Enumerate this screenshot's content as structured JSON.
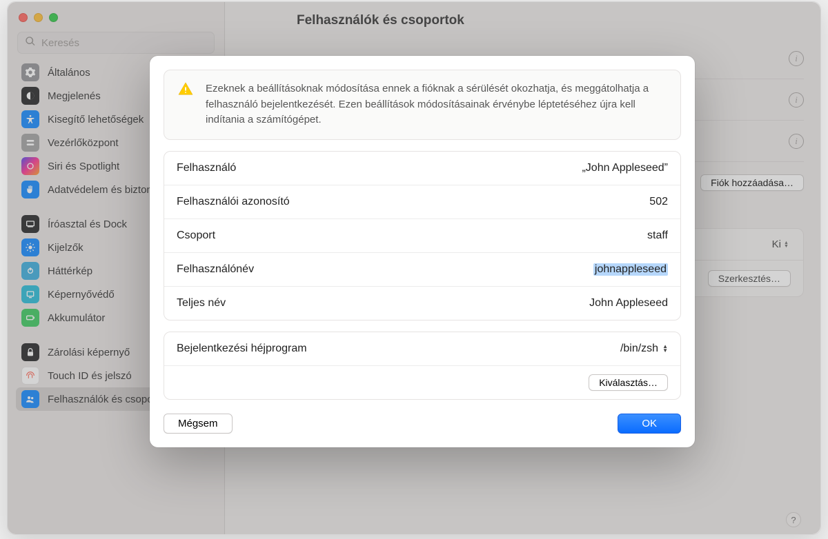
{
  "window": {
    "title": "Felhasználók és csoportok",
    "search_placeholder": "Keresés"
  },
  "sidebar": {
    "items": [
      {
        "label": "Általános",
        "color": "#8e8e93",
        "icon": "gear"
      },
      {
        "label": "Megjelenés",
        "color": "#1c1c1e",
        "icon": "appearance"
      },
      {
        "label": "Kisegítő lehetőségek",
        "color": "#0a84ff",
        "icon": "accessibility"
      },
      {
        "label": "Vezérlőközpont",
        "color": "#9e9e9e",
        "icon": "controls"
      },
      {
        "label": "Siri és Spotlight",
        "color": "#1b1b2b",
        "icon": "siri"
      },
      {
        "label": "Adatvédelem és biztonság",
        "color": "#0a84ff",
        "icon": "hand"
      }
    ],
    "items2": [
      {
        "label": "Íróasztal és Dock",
        "color": "#1c1c1e",
        "icon": "dock"
      },
      {
        "label": "Kijelzők",
        "color": "#0a84ff",
        "icon": "brightness"
      },
      {
        "label": "Háttérkép",
        "color": "#34aadc",
        "icon": "wallpaper"
      },
      {
        "label": "Képernyővédő",
        "color": "#20b9d6",
        "icon": "screensaver"
      },
      {
        "label": "Akkumulátor",
        "color": "#34c759",
        "icon": "battery"
      }
    ],
    "items3": [
      {
        "label": "Zárolási képernyő",
        "color": "#1c1c1e",
        "icon": "lock"
      },
      {
        "label": "Touch ID és jelszó",
        "color": "#ff5b49",
        "icon": "fingerprint"
      },
      {
        "label": "Felhasználók és csoportok",
        "color": "#0a84ff",
        "icon": "users"
      }
    ]
  },
  "background": {
    "add_account": "Fiók hozzáadása…",
    "auto_login_label": "",
    "auto_login_value": "Ki",
    "edit_button": "Szerkesztés…"
  },
  "modal": {
    "warning": "Ezeknek a beállításoknak módosítása ennek a fióknak a sérülését okozhatja, és meggátolhatja a felhasználó bejelentkezését. Ezen beállítások módosításainak érvénybe léptetéséhez újra kell indítania a számítógépet.",
    "fields": {
      "user_label": "Felhasználó",
      "user_value": "„John Appleseed”",
      "uid_label": "Felhasználói azonosító",
      "uid_value": "502",
      "group_label": "Csoport",
      "group_value": "staff",
      "username_label": "Felhasználónév",
      "username_value": "johnappleseed",
      "fullname_label": "Teljes név",
      "fullname_value": "John Appleseed"
    },
    "shell_label": "Bejelentkezési héjprogram",
    "shell_value": "/bin/zsh",
    "choose_button": "Kiválasztás…",
    "cancel": "Mégsem",
    "ok": "OK"
  }
}
